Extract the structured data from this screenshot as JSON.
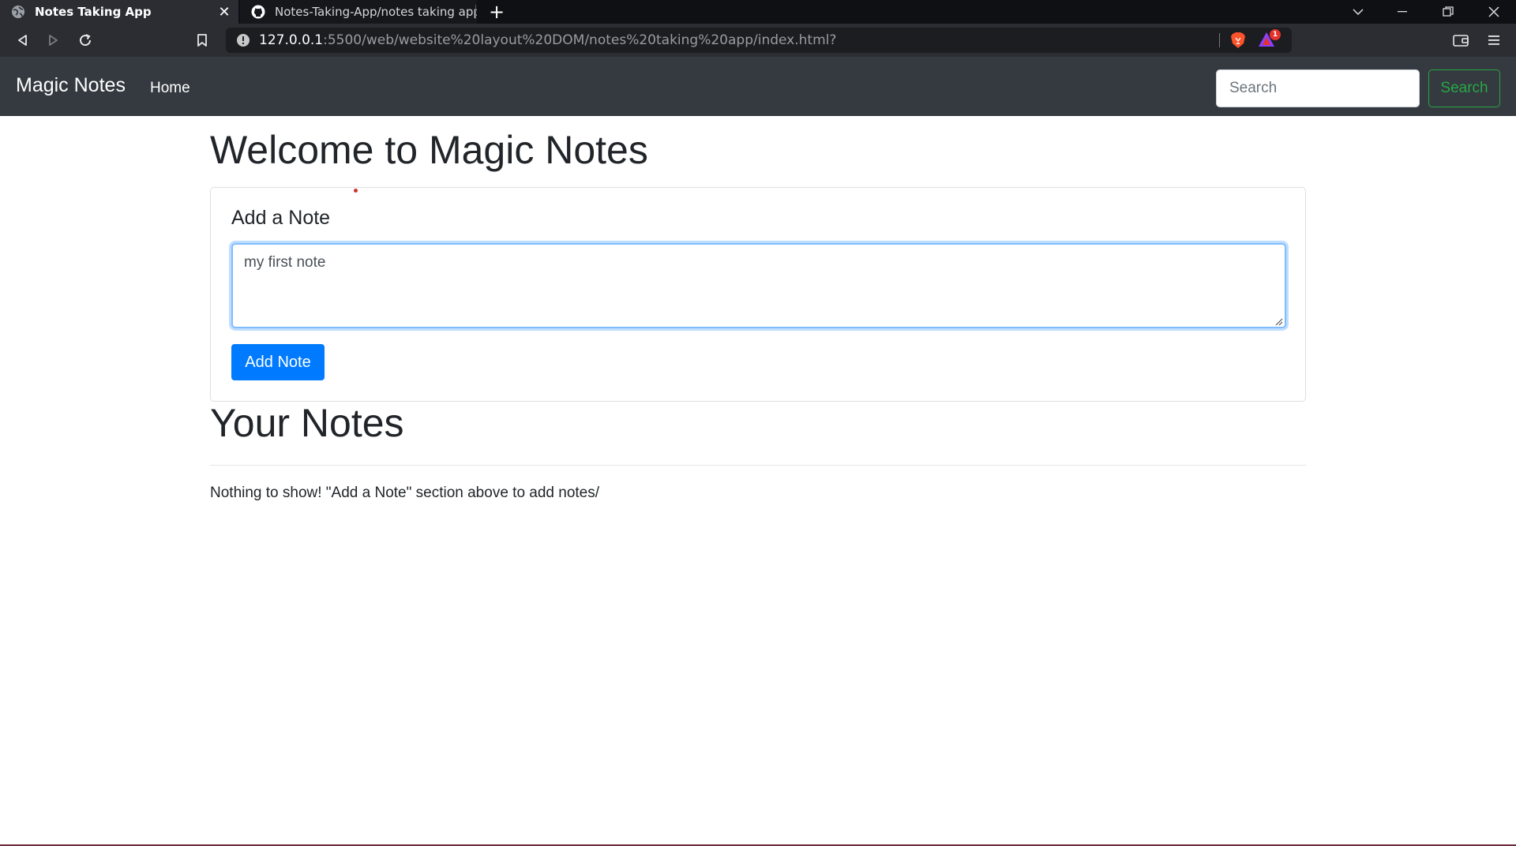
{
  "browser": {
    "tabs": [
      {
        "title": "Notes Taking App",
        "active": true,
        "favicon": "globe-icon"
      },
      {
        "title": "Notes-Taking-App/notes taking app/js",
        "active": false,
        "favicon": "github-icon"
      }
    ],
    "url": {
      "host": "127.0.0.1",
      "path": ":5500/web/website%20layout%20DOM/notes%20taking%20app/index.html?"
    },
    "rewards_badge": "1"
  },
  "navbar": {
    "brand": "Magic Notes",
    "home_label": "Home",
    "search_placeholder": "Search",
    "search_button": "Search"
  },
  "main": {
    "welcome_heading": "Welcome to Magic Notes",
    "card_title": "Add a Note",
    "note_value": "my first note",
    "add_button": "Add Note",
    "notes_heading": "Your Notes",
    "empty_message": "Nothing to show! \"Add a Note\" section above to add notes/"
  },
  "colors": {
    "navbar_bg": "#343a40",
    "primary": "#007bff",
    "success": "#28a745"
  }
}
